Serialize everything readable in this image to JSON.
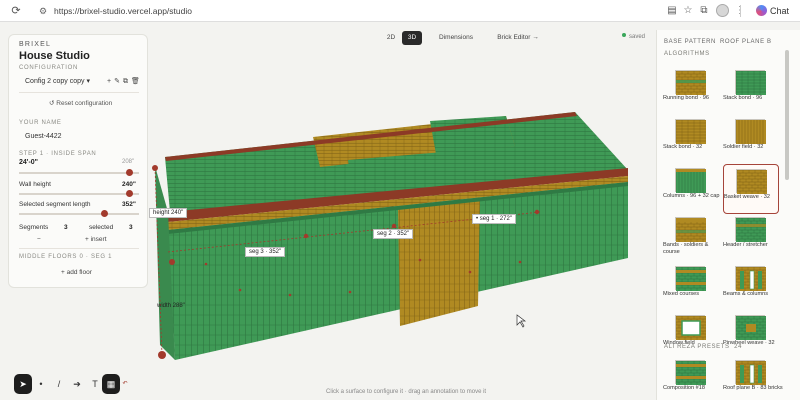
{
  "browser": {
    "url": "https://brixel-studio.vercel.app/studio",
    "chat_label": "Chat"
  },
  "left_panel": {
    "brand": "BRIXEL",
    "title": "House Studio",
    "configuration_label": "CONFIGURATION",
    "config_value": "Config 2 copy copy",
    "reset_label": "↺ Reset configuration",
    "your_name_label": "YOUR NAME",
    "name_value": "Guest-4422",
    "step_label": "STEP 1 · INSIDE SPAN",
    "span_value": "24'-0\"",
    "span_max": "208\"",
    "wall_height_label": "Wall height",
    "wall_height_value": "240\"",
    "segment_length_label": "Selected segment length",
    "segment_length_value": "352\"",
    "segments_label": "Segments",
    "segments_value": "3",
    "selected_label": "selected",
    "selected_value": "3",
    "minus_label": "−",
    "insert_label": "+ insert",
    "middle_floors_label": "MIDDLE FLOORS 0 · SEG 1",
    "add_floor_label": "+ add floor"
  },
  "view_tabs": [
    {
      "label": "2D"
    },
    {
      "label": "3D"
    },
    {
      "label": "Dimensions"
    },
    {
      "label": "Brick Editor →"
    }
  ],
  "status": "saved",
  "scene": {
    "labels": {
      "height": "height 240\"",
      "seg1": "• seg 1 · 272\"",
      "seg2": "seg 2 · 352\"",
      "seg3": "seg 3 · 352\"",
      "width": "width 288\""
    },
    "hint": "Click a surface to configure it · drag an annotation to move it"
  },
  "toolbar": [
    {
      "icon": "pointer-icon",
      "glyph": "➤"
    },
    {
      "icon": "dot-icon",
      "glyph": "•"
    },
    {
      "icon": "line-icon",
      "glyph": "/"
    },
    {
      "icon": "arrow-icon",
      "glyph": "➔"
    },
    {
      "icon": "text-icon",
      "glyph": "T"
    },
    {
      "icon": "grid-icon",
      "glyph": "▦"
    }
  ],
  "right_panel": {
    "base_pattern": "BASE PATTERN",
    "roof_plane": "ROOF PLANE B",
    "algorithms_label": "ALGORITHMS",
    "patterns": [
      {
        "name": "Running bond",
        "count": "96",
        "style": "running"
      },
      {
        "name": "Stack bond",
        "count": "96",
        "style": "stack-green"
      },
      {
        "name": "Stack bond",
        "count": "32",
        "style": "stack-gold"
      },
      {
        "name": "Soldier field",
        "count": "32",
        "style": "soldier"
      },
      {
        "name": "Columns",
        "count": "96 + 32 cap",
        "style": "columns"
      },
      {
        "name": "Basket weave",
        "count": "32",
        "style": "basket",
        "selected": true
      },
      {
        "name": "Bands · soldiers & course",
        "count": "",
        "style": "bands"
      },
      {
        "name": "Header / stretcher",
        "count": "",
        "style": "header"
      },
      {
        "name": "Mixed courses",
        "count": "",
        "style": "mixed"
      },
      {
        "name": "Beams & columns",
        "count": "",
        "style": "beams"
      },
      {
        "name": "Window field",
        "count": "",
        "style": "window"
      },
      {
        "name": "Pinwheel weave",
        "count": "32",
        "style": "pinwheel"
      }
    ],
    "presets_label": "ALI REZA PRESETS",
    "presets_count": "24",
    "presets": [
      {
        "name": "Composition #18"
      },
      {
        "name": "Roof plane B · 83 bricks"
      }
    ]
  },
  "colors": {
    "brick_green": "#3f9a56",
    "brick_gold": "#b08a22",
    "roof_red": "#8c3a26",
    "accent_red": "#a6443a"
  }
}
